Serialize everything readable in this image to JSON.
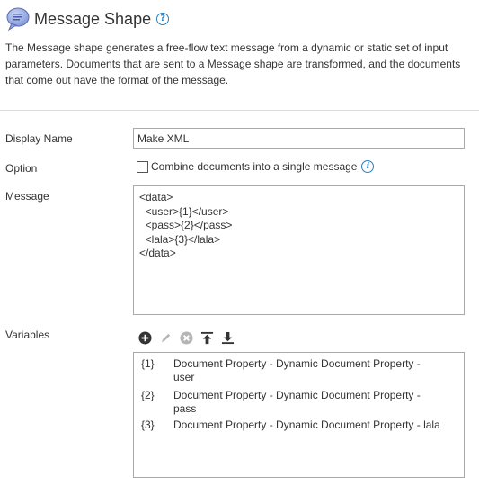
{
  "header": {
    "title": "Message Shape",
    "help_glyph": "?"
  },
  "description": "The Message shape generates a free-flow text message from a dynamic or static set of input parameters. Documents that are sent to a Message shape are transformed, and the documents that come out have the format of the message.",
  "form": {
    "display_name_label": "Display Name",
    "display_name_value": "Make XML",
    "option_label": "Option",
    "combine_label": "Combine documents into a single message",
    "combine_checked": false,
    "info_glyph": "i",
    "message_label": "Message",
    "message_value": "<data>\n  <user>{1}</user>\n  <pass>{2}</pass>\n  <lala>{3}</lala>\n</data>",
    "variables_label": "Variables"
  },
  "toolbar": {
    "icons": [
      "add-icon",
      "edit-icon",
      "delete-icon",
      "move-top-icon",
      "move-bottom-icon"
    ]
  },
  "variables": [
    {
      "key": "{1}",
      "value": "Document Property - Dynamic Document Property - user"
    },
    {
      "key": "{2}",
      "value": "Document Property - Dynamic Document Property - pass"
    },
    {
      "key": "{3}",
      "value": "Document Property - Dynamic Document Property - lala"
    }
  ],
  "colors": {
    "accent": "#2a7fc1",
    "border": "#a9a9a9",
    "icon_active": "#333333",
    "icon_disabled": "#b5b5b5"
  }
}
